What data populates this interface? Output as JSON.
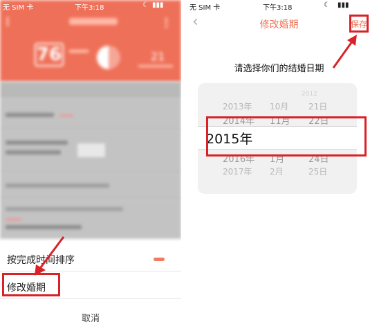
{
  "left": {
    "status": {
      "carrier": "无 SIM 卡",
      "time": "下午3:18"
    },
    "header": {
      "score": "76",
      "stat": "21"
    },
    "sheet": {
      "sort_label": "按完成时间排序",
      "edit_wedding_label": "修改婚期",
      "cancel_label": "取消"
    }
  },
  "right": {
    "status": {
      "carrier": "无 SIM 卡",
      "time": "下午3:18"
    },
    "nav": {
      "title": "修改婚期",
      "save_label": "保存"
    },
    "prompt": "请选择你们的结婚日期",
    "picker": {
      "top_faint": "2012",
      "rows": [
        {
          "year": "2013年",
          "month": "10月",
          "day": "21日"
        },
        {
          "year": "2014年",
          "month": "11月",
          "day": "22日"
        },
        {
          "year": "2016年",
          "month": "1月",
          "day": "24日"
        },
        {
          "year": "2017年",
          "month": "2月",
          "day": "25日"
        }
      ],
      "selected_year": "2015年"
    }
  },
  "colors": {
    "accent": "#ef6f53",
    "highlight": "#d82228"
  },
  "icons": {
    "back": "chevron-left-icon",
    "arrow": "red-arrow-annotation"
  }
}
